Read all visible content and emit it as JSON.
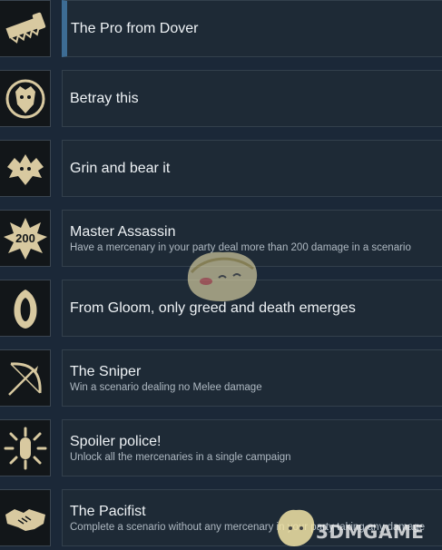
{
  "achievements": [
    {
      "icon": "saw-icon",
      "title": "The Pro from Dover",
      "description": "",
      "selected": true
    },
    {
      "icon": "bear-head-icon",
      "title": "Betray this",
      "description": ""
    },
    {
      "icon": "bear-crest-icon",
      "title": "Grin and bear it",
      "description": ""
    },
    {
      "icon": "burst-200-icon",
      "title": "Master Assassin",
      "description": "Have a mercenary in your party deal more than 200 damage in a scenario",
      "badge": "200"
    },
    {
      "icon": "hooded-figure-icon",
      "title": "From Gloom, only greed and death emerges",
      "description": ""
    },
    {
      "icon": "bow-icon",
      "title": "The Sniper",
      "description": "Win a scenario dealing no Melee damage"
    },
    {
      "icon": "sun-emblem-icon",
      "title": "Spoiler police!",
      "description": "Unlock all the mercenaries in a single campaign"
    },
    {
      "icon": "handshake-icon",
      "title": "The Pacifist",
      "description": "Complete a scenario without any mercenary in your party taking any damage"
    }
  ],
  "watermark": {
    "text": "3DMGAME"
  },
  "colors": {
    "background": "#1b2838",
    "card": "#1e2a36",
    "icon_gold": "#d8c9a0",
    "selected_accent": "#3d6c94"
  }
}
